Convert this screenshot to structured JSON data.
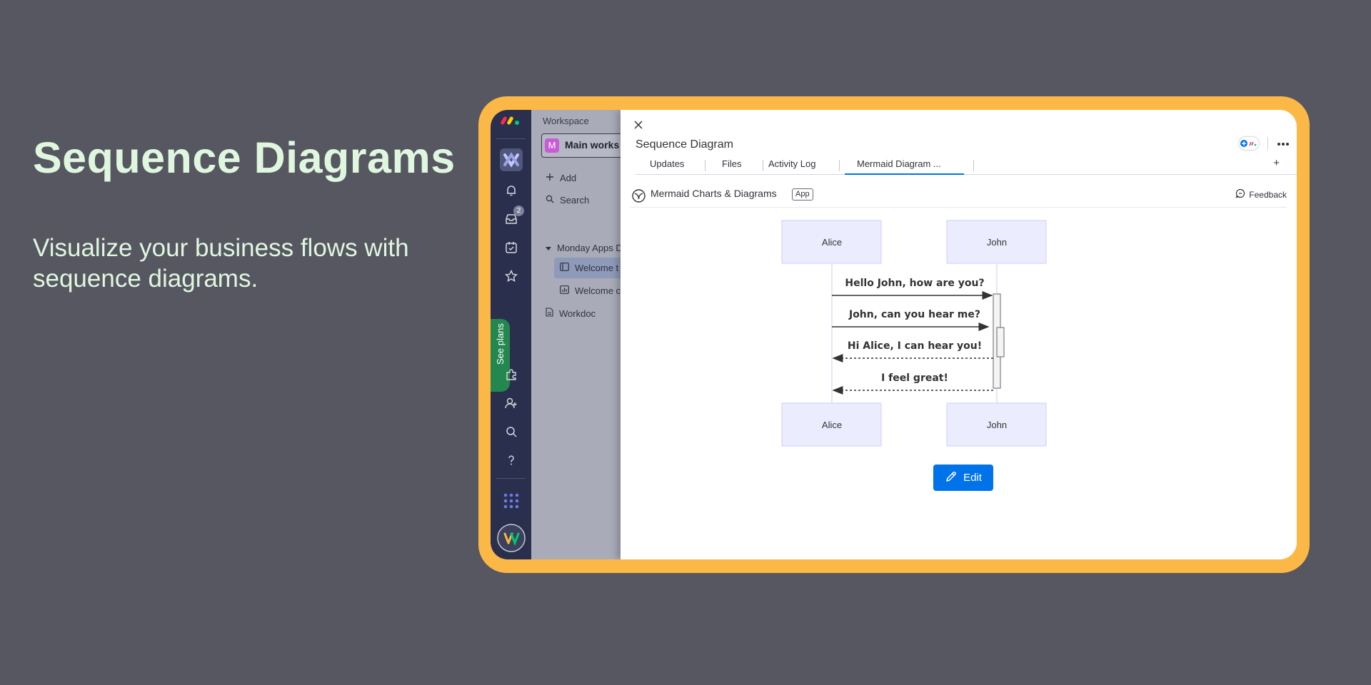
{
  "hero": {
    "title": "Sequence Diagrams",
    "subtitle": "Visualize your business flows with sequence diagrams."
  },
  "rail": {
    "inbox_badge": "2",
    "see_plans": "See plans",
    "icons": [
      "monday-logo-icon",
      "workspace-logo-icon",
      "bell-icon",
      "inbox-icon",
      "calendar-check-icon",
      "star-icon",
      "puzzle-icon",
      "add-person-icon",
      "search-icon",
      "help-icon",
      "apps-grid-icon",
      "user-avatar-icon"
    ]
  },
  "workspace": {
    "label": "Workspace",
    "avatar_letter": "M",
    "name": "Main works",
    "add": "Add",
    "search": "Search",
    "folder": "Monday Apps D",
    "item_1": "Welcome t",
    "item_2": "Welcome c",
    "item_3": "Workdoc"
  },
  "panel": {
    "title": "Sequence Diagram",
    "tabs": [
      "Updates",
      "Files",
      "Activity Log",
      "Mermaid Diagram ..."
    ],
    "active_tab": "Mermaid Diagram ...",
    "plus": "+",
    "app_name": "Mermaid Charts & Diagrams",
    "app_tag": "App",
    "feedback": "Feedback",
    "edit_label": "Edit"
  },
  "diagram": {
    "participants": [
      "Alice",
      "John"
    ],
    "messages": [
      {
        "from": "Alice",
        "to": "John",
        "text": "Hello John, how are you?",
        "style": "solid"
      },
      {
        "from": "Alice",
        "to": "John",
        "text": "John, can you hear me?",
        "style": "solid"
      },
      {
        "from": "John",
        "to": "Alice",
        "text": "Hi Alice, I can hear you!",
        "style": "dotted"
      },
      {
        "from": "John",
        "to": "Alice",
        "text": "I feel great!",
        "style": "dotted"
      }
    ]
  },
  "colors": {
    "background": "#575761",
    "frame": "#fcb846",
    "hero_text": "#dff7df",
    "accent": "#0073ea",
    "rail": "#292f4c",
    "participant_fill": "#ececff",
    "participant_border": "#ccccff"
  }
}
